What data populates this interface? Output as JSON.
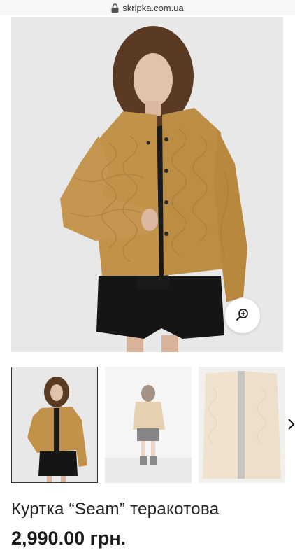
{
  "browser": {
    "url": "skripka.com.ua"
  },
  "product": {
    "title": "Куртка “Seam” теракотова",
    "price": "2,990.00 грн."
  },
  "gallery": {
    "main_image": "product-photo-front",
    "zoom_icon": "zoom-in-icon",
    "thumbnails": [
      "thumb-front",
      "thumb-back",
      "thumb-detail"
    ],
    "next_icon": "chevron-right-icon",
    "selected_index": 0
  },
  "colors": {
    "jacket": "#c0924a",
    "background": "#e8e8e8",
    "text": "#222222"
  }
}
